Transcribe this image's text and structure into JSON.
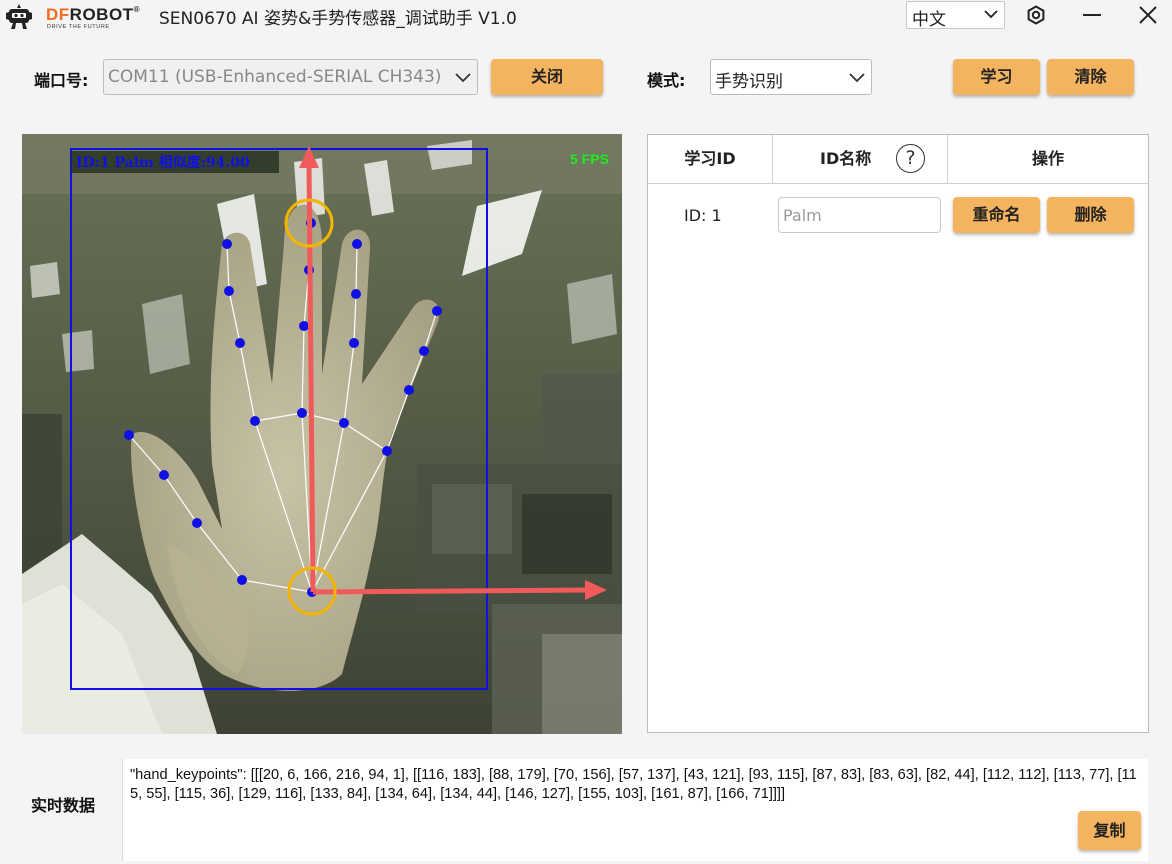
{
  "window": {
    "brand_prefix": "DF",
    "brand_suffix": "ROBOT",
    "brand_mark": "®",
    "slogan": "DRIVE THE FUTURE",
    "title": "SEN0670 AI 姿势&手势传感器_调试助手 V1.0",
    "language": "中文",
    "icons": [
      "robot-logo-icon",
      "gear-icon",
      "minimize-icon",
      "close-icon"
    ]
  },
  "toolbar": {
    "port_label": "端口号:",
    "port_value": "COM11 (USB-Enhanced-SERIAL CH343)",
    "close_label": "关闭",
    "mode_label": "模式:",
    "mode_value": "手势识别",
    "learn_label": "学习",
    "clear_label": "清除"
  },
  "camera": {
    "detection_label": "ID:1 Palm 相似度:94.00",
    "fps": "5 FPS",
    "colors": {
      "box": "#1010e6",
      "keypoint": "#1010e6",
      "arrow": "#f05a5a",
      "circle": "#f5b400",
      "fps": "#22e822"
    }
  },
  "table": {
    "headers": [
      "学习ID",
      "ID名称",
      "操作"
    ],
    "help_symbol": "?",
    "rows": [
      {
        "id": "ID: 1",
        "name_placeholder": "Palm",
        "rename_label": "重命名",
        "delete_label": "删除"
      }
    ]
  },
  "realtime": {
    "label": "实时数据",
    "text": "\"hand_keypoints\": [[[20, 6, 166, 216, 94, 1], [[116, 183], [88, 179], [70, 156], [57, 137], [43, 121], [93, 115], [87, 83], [83, 63], [82, 44], [112, 112], [113, 77], [115, 55], [115, 36], [129, 116], [133, 84], [134, 64], [134, 44], [146, 127], [155, 103], [161, 87], [166, 71]]]]",
    "copy_label": "复制"
  }
}
